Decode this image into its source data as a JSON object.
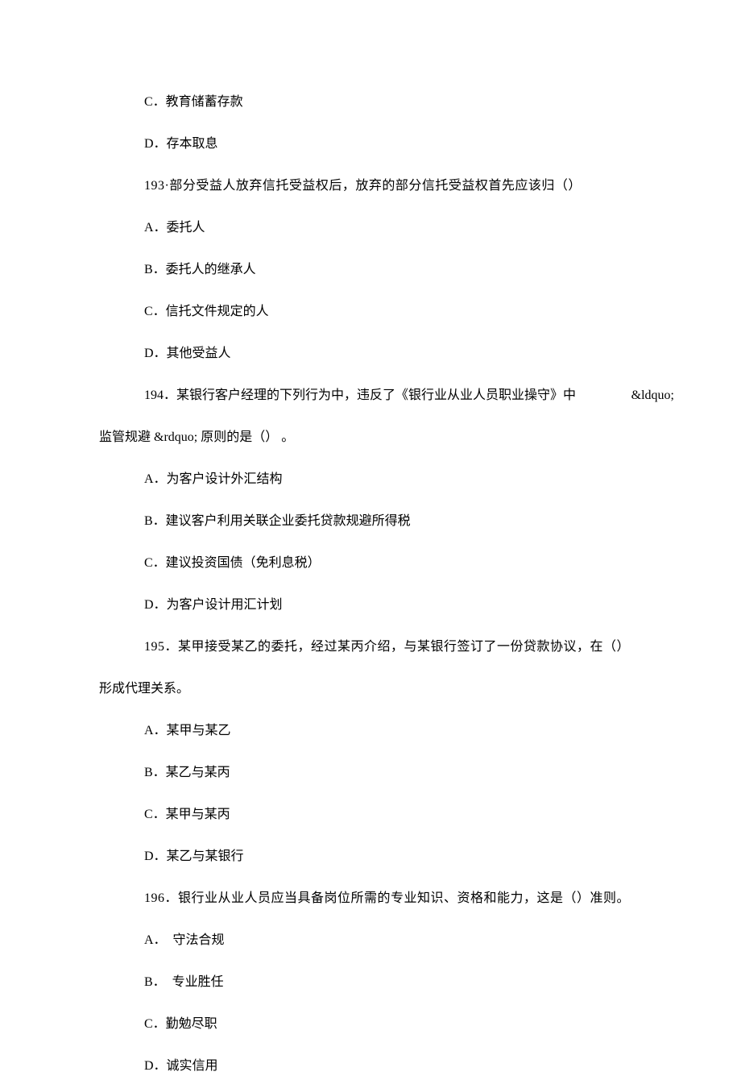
{
  "items": [
    {
      "cls": "option",
      "text": "C．教育储蓄存款"
    },
    {
      "cls": "option",
      "text": "D．存本取息"
    },
    {
      "cls": "question lspace",
      "text": "193·部分受益人放弃信托受益权后，放弃的部分信托受益权首先应该归（）"
    },
    {
      "cls": "option",
      "text": "A．委托人"
    },
    {
      "cls": "option",
      "text": "B．委托人的继承人"
    },
    {
      "cls": "option",
      "text": "C．信托文件规定的人"
    },
    {
      "cls": "option",
      "text": "D．其他受益人"
    },
    {
      "cls": "question q194",
      "main": "194．某银行客户经理的下列行为中，违反了《银行业从业人员职业操守》中",
      "right": "&ldquo;"
    },
    {
      "cls": "question-continue",
      "text": "监管规避 &rdquo; 原则的是（） 。"
    },
    {
      "cls": "option",
      "text": "A．为客户设计外汇结构"
    },
    {
      "cls": "option",
      "text": "B．建议客户利用关联企业委托贷款规避所得税"
    },
    {
      "cls": "option",
      "text": "C．建议投资国债（免利息税）"
    },
    {
      "cls": "option",
      "text": "D．为客户设计用汇计划"
    },
    {
      "cls": "question lspace",
      "text": "195．某甲接受某乙的委托，经过某丙介绍，与某银行签订了一份贷款协议，在（）"
    },
    {
      "cls": "question-continue",
      "text": "形成代理关系。"
    },
    {
      "cls": "option",
      "text": "A．某甲与某乙"
    },
    {
      "cls": "option",
      "text": "B．某乙与某丙"
    },
    {
      "cls": "option",
      "text": "C．某甲与某丙"
    },
    {
      "cls": "option",
      "text": "D．某乙与某银行"
    },
    {
      "cls": "question lspace",
      "text": "196．银行业从业人员应当具备岗位所需的专业知识、资格和能力，这是（）准则。"
    },
    {
      "cls": "option",
      "text": "A．　守法合规"
    },
    {
      "cls": "option",
      "text": "B．　专业胜任"
    },
    {
      "cls": "option",
      "text": "C．勤勉尽职"
    },
    {
      "cls": "option",
      "text": "D．诚实信用"
    }
  ]
}
